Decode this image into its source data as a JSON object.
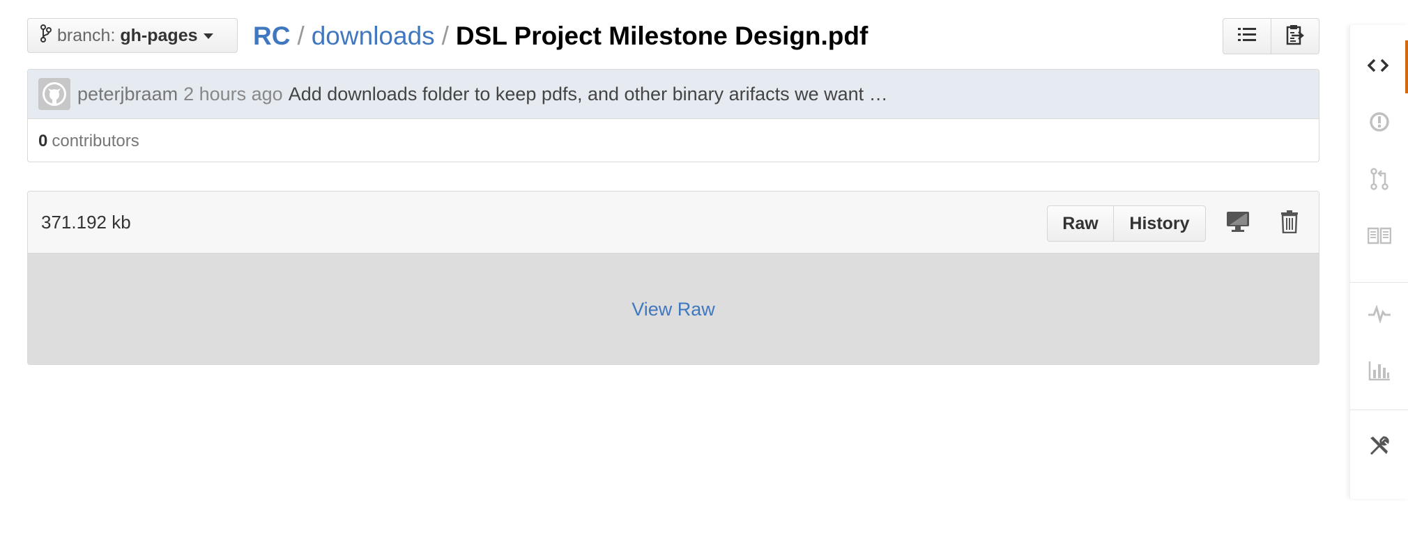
{
  "branch": {
    "label": "branch:",
    "value": "gh-pages"
  },
  "breadcrumb": {
    "root": "RC",
    "sep1": "/",
    "folder": "downloads",
    "sep2": "/",
    "file": "DSL Project Milestone Design.pdf"
  },
  "commit": {
    "author": "peterjbraam",
    "time": "2 hours ago",
    "message": "Add downloads folder to keep pdfs, and other binary arifacts we want …"
  },
  "contributors": {
    "count": "0",
    "label": "contributors"
  },
  "file": {
    "size": "371.192 kb",
    "raw_label": "Raw",
    "history_label": "History",
    "view_raw_label": "View Raw"
  },
  "colors": {
    "link": "#4078c0",
    "accent": "#d26911",
    "commit_bg": "#e6ebf1"
  },
  "icons": {
    "toolbar": [
      "list-icon",
      "clipboard-icon"
    ],
    "file_actions": [
      "desktop-icon",
      "trash-icon"
    ],
    "side_nav": [
      "code-icon",
      "issue-opened-icon",
      "git-pull-request-icon",
      "book-icon",
      "pulse-icon",
      "graph-icon",
      "tools-icon"
    ]
  }
}
